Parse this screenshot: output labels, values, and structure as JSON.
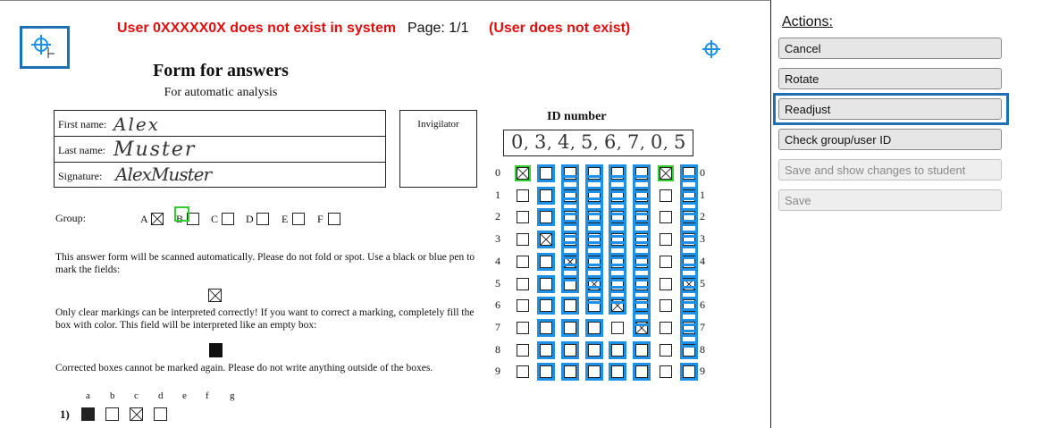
{
  "header": {
    "error_user": "User 0XXXXX0X does not exist in system",
    "page": "Page: 1/1",
    "error_short": "(User does not exist)"
  },
  "form": {
    "title": "Form for answers",
    "subtitle": "For automatic analysis",
    "first_name_label": "First name:",
    "first_name_value": "Alex",
    "last_name_label": "Last name:",
    "last_name_value": "Muster",
    "signature_label": "Signature:",
    "signature_value": "AlexMuster",
    "invigilator_label": "Invigilator",
    "id_title": "ID number",
    "id_digits": [
      "0",
      "3",
      "4",
      "5",
      "6",
      "7",
      "0",
      "5"
    ],
    "group_label": "Group:",
    "group_options": [
      "A",
      "B",
      "C",
      "D",
      "E",
      "F"
    ],
    "instruction1": "This answer form will be scanned automatically. Please do not fold or spot. Use a black or blue pen to mark the fields:",
    "instruction2": "Only clear markings can be interpreted correctly! If you want to correct a marking, completely fill the box with color. This field will be interpreted like an empty box:",
    "instruction3": "Corrected boxes cannot be marked again. Please do not write anything outside of the boxes.",
    "answer_columns": [
      "a",
      "b",
      "c",
      "d",
      "e",
      "f",
      "g"
    ],
    "question_label": "1)",
    "row_digits": [
      "0",
      "1",
      "2",
      "3",
      "4",
      "5",
      "6",
      "7",
      "8",
      "9"
    ]
  },
  "actions": {
    "title": "Actions:",
    "buttons": [
      {
        "label": "Cancel",
        "enabled": true
      },
      {
        "label": "Rotate",
        "enabled": true
      },
      {
        "label": "Readjust",
        "enabled": true,
        "focused": true
      },
      {
        "label": "Check group/user ID",
        "enabled": true
      },
      {
        "label": "Save and show changes to student",
        "enabled": false
      },
      {
        "label": "Save",
        "enabled": false
      }
    ]
  },
  "colors": {
    "error": "#e01010",
    "overlay": "#1e90e6",
    "overlay_match": "#33cc33",
    "focus_border": "#1f6fb5"
  }
}
